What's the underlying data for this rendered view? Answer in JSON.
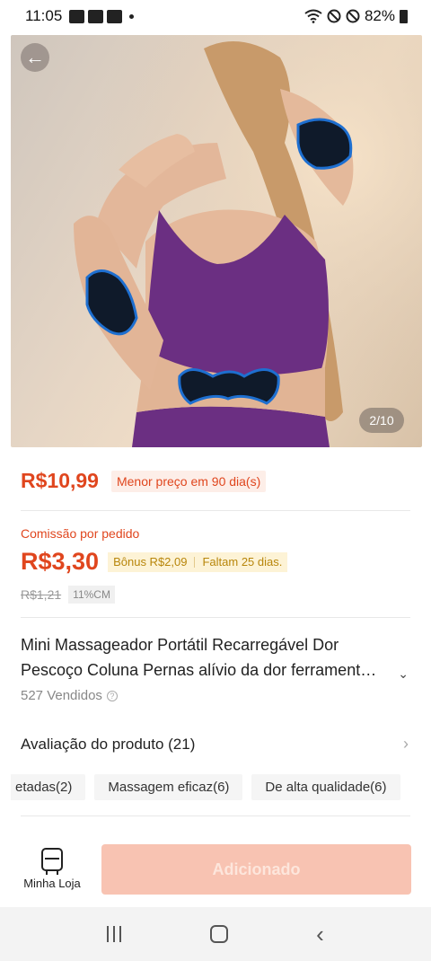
{
  "status_bar": {
    "time": "11:05",
    "battery": "82%",
    "icons": [
      "gallery-icon",
      "voicemail-icon",
      "voicemail-icon",
      "wifi-icon",
      "block-icon",
      "block-icon",
      "battery-icon"
    ]
  },
  "gallery": {
    "counter": "2/10",
    "back_icon": "arrow-left-icon"
  },
  "price": {
    "current": "R$10,99",
    "badge": "Menor preço em 90 dia(s)"
  },
  "commission": {
    "label": "Comissão por pedido",
    "value": "R$3,30",
    "bonus": "Bônus R$2,09",
    "days_left": "Faltam 25 dias.",
    "old_price": "R$1,21",
    "rate": "11%CM"
  },
  "product": {
    "title_line1": "Mini Massageador Portátil Recarregável Dor",
    "title_line2": "Pescoço Coluna Pernas alívio da dor ferrament…",
    "sold": "527 Vendidos"
  },
  "reviews": {
    "title": "Avaliação do produto (21)",
    "chips": [
      "etadas(2)",
      "Massagem eficaz(6)",
      "De alta qualidade(6)"
    ]
  },
  "bottom": {
    "store_label": "Minha Loja",
    "add_label": "Adicionado"
  },
  "colors": {
    "accent": "#e0461e",
    "add_button": "#f8c3b2",
    "bonus_bg": "#fdf3d6"
  }
}
